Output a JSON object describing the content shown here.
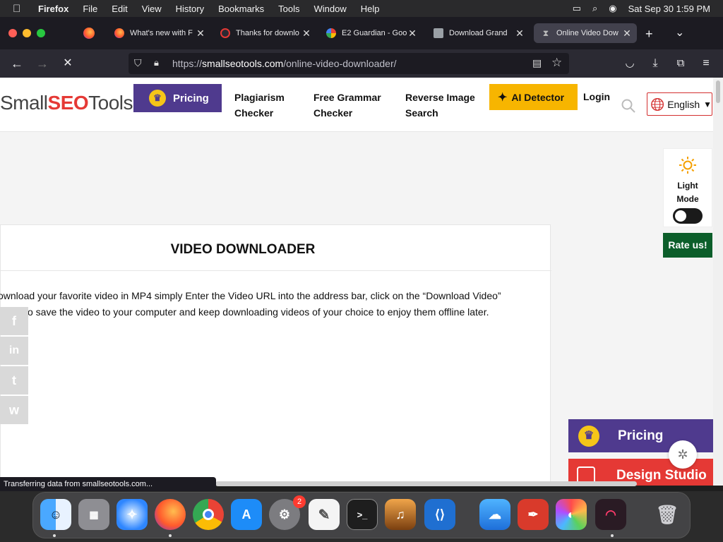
{
  "menubar": {
    "app": "Firefox",
    "items": [
      "File",
      "Edit",
      "View",
      "History",
      "Bookmarks",
      "Tools",
      "Window",
      "Help"
    ],
    "clock": "Sat Sep 30  1:59 PM"
  },
  "tabs": [
    {
      "title": "What's new with F"
    },
    {
      "title": "Thanks for downlo"
    },
    {
      "title": "E2 Guardian - Goo"
    },
    {
      "title": "Download Grand"
    },
    {
      "title": "Online Video Dow"
    }
  ],
  "urlbar": {
    "scheme": "https://",
    "domain": "smallseotools.com",
    "path": "/online-video-downloader/"
  },
  "site": {
    "logo_left": "Small",
    "logo_mid": "SEO",
    "logo_right": "Tools",
    "pricing": "Pricing",
    "nav": [
      {
        "line1": "Plagiarism",
        "line2": "Checker"
      },
      {
        "line1": "Free Grammar",
        "line2": "Checker"
      },
      {
        "line1": "Reverse Image",
        "line2": "Search"
      }
    ],
    "ai_detector": "AI Detector",
    "login": "Login",
    "language": "English"
  },
  "main": {
    "title": "VIDEO DOWNLOADER",
    "line1": "ownload your favorite video in MP4 simply Enter the Video URL into the address bar, click on the “Download Video”",
    "line2": "o save the video to your computer and keep downloading videos of your choice to enjoy them offline later."
  },
  "share": [
    "f",
    "in",
    "t",
    "w"
  ],
  "mode": {
    "line1": "Light",
    "line2": "Mode"
  },
  "rate": "Rate us!",
  "side": {
    "pricing": "Pricing",
    "design": "Design Studio"
  },
  "status": "Transferring data from smallseotools.com...",
  "dock": {
    "badge": "2"
  },
  "colors": {
    "accent_purple": "#4f3a8e",
    "ai_yellow": "#f7b500",
    "rate_green": "#0c5e2a",
    "brand_red": "#e53935"
  }
}
